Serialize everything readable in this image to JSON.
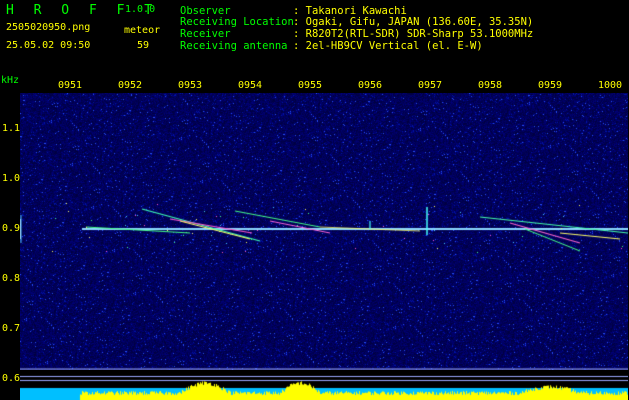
{
  "app": {
    "name": "H R O F F T",
    "version": "1.0.0"
  },
  "file": {
    "name": "2505020950.png",
    "datetime": "25.05.02 09:50"
  },
  "meteor": {
    "label": "meteor",
    "count": "59"
  },
  "info": {
    "labels": [
      "Observer",
      "Receiving Location",
      "Receiver",
      "Receiving antenna"
    ],
    "values": [
      ": Takanori Kawachi",
      ": Ogaki, Gifu, JAPAN (136.60E, 35.35N)",
      ": R820T2(RTL-SDR) SDR-Sharp 53.1000MHz",
      ": 2el-HB9CV Vertical (el. E-W)"
    ]
  },
  "axis": {
    "unit": "kHz",
    "x_ticks": [
      "0951",
      "0952",
      "0953",
      "0954",
      "0955",
      "0956",
      "0957",
      "0958",
      "0959",
      "1000"
    ],
    "y_ticks": [
      "1.1",
      "1.0",
      "0.9",
      "0.8",
      "0.7",
      "0.6"
    ]
  },
  "colors": {
    "label": "#00ff00",
    "value": "#ffff00",
    "background": "#000000",
    "noise": "#000080",
    "carrier": "#4fc3ff",
    "bottom_bar": "#00bfff",
    "bottom_peaks": "#ffff00"
  }
}
